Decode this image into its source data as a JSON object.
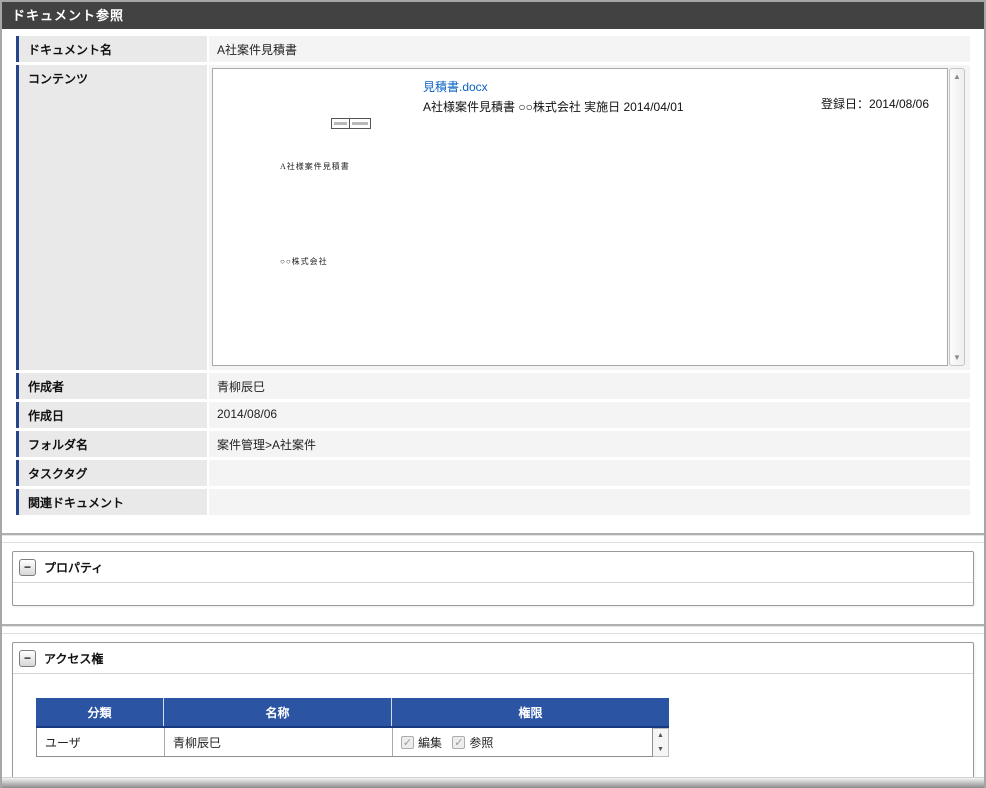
{
  "page": {
    "title": "ドキュメント参照"
  },
  "form": {
    "rows": [
      {
        "label": "ドキュメント名",
        "value": "A社案件見積書"
      },
      {
        "label": "コンテンツ",
        "value": ""
      },
      {
        "label": "作成者",
        "value": "青柳辰巳"
      },
      {
        "label": "作成日",
        "value": "2014/08/06"
      },
      {
        "label": "フォルダ名",
        "value": "案件管理>A社案件"
      },
      {
        "label": "タスクタグ",
        "value": ""
      },
      {
        "label": "関連ドキュメント",
        "value": ""
      }
    ]
  },
  "content": {
    "file_link": "見積書.docx",
    "description": "A社様案件見積書 ○○株式会社 実施日 2014/04/01",
    "registered_label": "登録日：2014/08/06",
    "preview": {
      "doc_title": "A社様案件見積書",
      "doc_company": "○○株式会社"
    }
  },
  "sections": {
    "properties": {
      "title": "プロパティ"
    },
    "access": {
      "title": "アクセス権",
      "table": {
        "headers": [
          "分類",
          "名称",
          "権限"
        ],
        "rows": [
          {
            "category": "ユーザ",
            "name": "青柳辰巳",
            "permissions": [
              {
                "label": "編集",
                "checked": true,
                "mark": "✓"
              },
              {
                "label": "参照",
                "checked": true,
                "mark": "✓"
              }
            ]
          }
        ]
      }
    }
  },
  "icons": {
    "collapse_minus": "−",
    "arrow_up": "▲",
    "arrow_down": "▼"
  },
  "colors": {
    "titlebar": "#424242",
    "accent_blue": "#26458c",
    "table_header_blue": "#2b55a2",
    "link_blue": "#0b61c4",
    "label_bg": "#e9e9e9",
    "value_bg": "#f4f4f4"
  }
}
